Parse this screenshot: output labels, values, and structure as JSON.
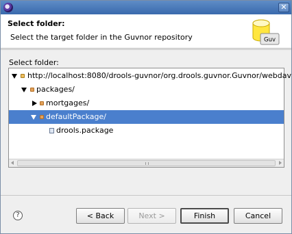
{
  "window": {
    "title": ""
  },
  "banner": {
    "title": "Select folder:",
    "description": "Select the target folder in the Guvnor repository",
    "image_label": "Guv"
  },
  "field_label": "Select folder:",
  "tree": {
    "rows": [
      {
        "label": "http://localhost:8080/drools-guvnor/org.drools.guvnor.Guvnor/webdav",
        "expanded": true,
        "icon": "server-icon",
        "selected": false
      },
      {
        "label": "packages/",
        "expanded": true,
        "icon": "folder-icon",
        "selected": false
      },
      {
        "label": "mortgages/",
        "expanded": false,
        "icon": "folder-icon",
        "selected": false
      },
      {
        "label": "defaultPackage/",
        "expanded": true,
        "icon": "folder-icon",
        "selected": true
      },
      {
        "label": "drools.package",
        "expanded": null,
        "icon": "file-icon",
        "selected": false
      }
    ]
  },
  "buttons": {
    "help": "?",
    "back": "< Back",
    "next": "Next >",
    "finish": "Finish",
    "cancel": "Cancel"
  },
  "colors": {
    "titlebar": "#3a6aad",
    "selection": "#4a7fcd"
  }
}
